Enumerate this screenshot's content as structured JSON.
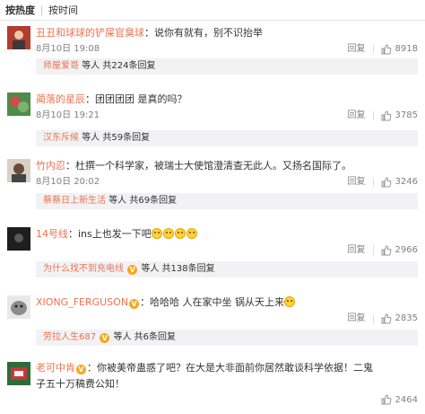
{
  "sort": {
    "hot": "按热度",
    "time": "按时间"
  },
  "actions": {
    "reply": "回复"
  },
  "comments": [
    {
      "username": "丑丑和球球的铲屎官臭球",
      "text": "：说你有就有，别不识抬举",
      "time": "8月10日 19:08",
      "likes": "8918",
      "replies": {
        "names": "师屋爱哥",
        "suffix": "等人 共224条回复"
      },
      "avatar_color": "#b23c2e"
    },
    {
      "username": "蔺落的星辰",
      "text": "：团团团团 是真的吗？",
      "time": "8月10日 19:21",
      "likes": "3785",
      "replies": {
        "names": "汉东斥候",
        "suffix": "等人 共59条回复"
      },
      "avatar_color": "#4e8c4a"
    },
    {
      "username": "竹内忍",
      "text": "：杜撰一个科学家，被瑞士大使馆澄清查无此人。又扬名国际了。",
      "time": "8月10日 20:02",
      "likes": "3246",
      "replies": {
        "names": "蔡蔡日上新生活",
        "suffix": "等人 共69条回复"
      },
      "avatar_color": "#6b4a3a"
    },
    {
      "username": "14号线",
      "text": "：ins上也发一下吧",
      "time": "8月10日 19:40",
      "likes": "2966",
      "replies": {
        "names": "为什么找不到充电线",
        "suffix": "等人 共138条回复"
      },
      "avatar_color": "#1e1e1e"
    },
    {
      "username": "XIONG_FERGUSON",
      "text": "：哈哈哈 人在家中坐 锅从天上来",
      "time": "8月10日 19:08",
      "likes": "2835",
      "replies": {
        "names": "劳拉人生687",
        "suffix": "等人 共6条回复"
      },
      "avatar_color": "#8c8c8c"
    },
    {
      "username": "老可中肯",
      "text": "：你被美帝蛊惑了吧？在大是大非面前你居然敢谈科学依据！二鬼子五十万稿费公知！",
      "time": "",
      "likes": "2464",
      "avatar_color": "#2e6b3a"
    }
  ]
}
